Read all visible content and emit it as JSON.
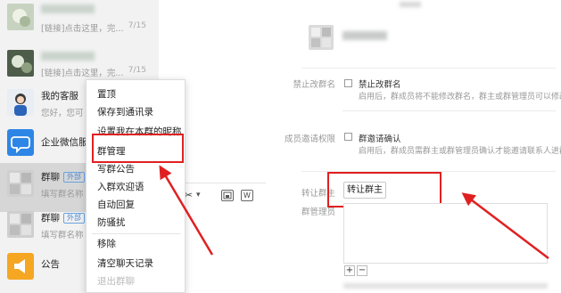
{
  "left_panel": {
    "chat_list": [
      {
        "name": "",
        "preview": "[链接]点击这里，完...",
        "time": "7/15",
        "avatar": "flower-photo-avatar"
      },
      {
        "name": "",
        "preview": "[链接]点击这里，完...",
        "time": "7/15",
        "avatar": "flower-photo-avatar"
      },
      {
        "name": "我的客服",
        "preview": "您好，您可",
        "time": "",
        "avatar": "customer-service-avatar"
      },
      {
        "name": "企业微信服",
        "preview": "",
        "time": "",
        "avatar": "chat-bubble-avatar"
      },
      {
        "name": "群聊",
        "tag": "外部",
        "preview": "填写群名称",
        "time": "",
        "avatar": "group-avatar"
      },
      {
        "name": "群聊",
        "tag": "外部",
        "preview": "填写群名称",
        "time": "",
        "avatar": "group-avatar"
      },
      {
        "name": "公告",
        "preview": "",
        "time": "",
        "avatar": "announcement-avatar"
      }
    ],
    "context_menu": {
      "items": [
        "置顶",
        "保存到通讯录",
        "设置我在本群的昵称",
        "群管理",
        "写群公告",
        "入群欢迎语",
        "自动回复",
        "防骚扰",
        "移除",
        "清空聊天记录",
        "退出群聊"
      ],
      "highlighted": "群管理",
      "disabled": "退出群聊"
    },
    "toolbar": {
      "scissors_icon": "✂",
      "dropdown_icon": "▾",
      "image_icon": "▪",
      "word_icon": "W"
    }
  },
  "right_panel": {
    "settings": [
      {
        "label": "禁止改群名",
        "option": "禁止改群名",
        "desc": "启用后，群成员将不能修改群名，群主或群管理员可以修改"
      },
      {
        "label": "成员邀请权限",
        "option": "群邀请确认",
        "desc": "启用后，群成员需群主或群管理员确认才能邀请联系人进群"
      }
    ],
    "transfer": {
      "label": "转让群主",
      "button": "转让群主"
    },
    "admins": {
      "label": "群管理员"
    },
    "add_button": "+",
    "remove_button": "−"
  },
  "colors": {
    "highlight": "#e02020",
    "arrow": "#e02020",
    "tag": "#4a88d1"
  }
}
